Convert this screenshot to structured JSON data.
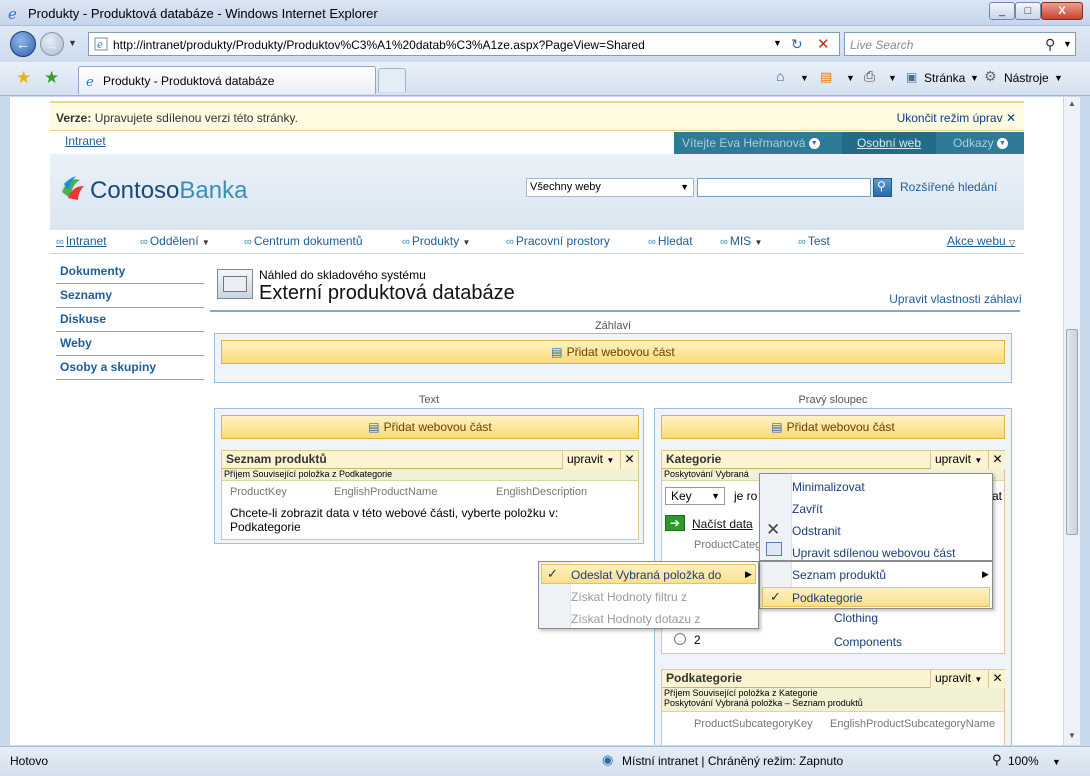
{
  "window": {
    "title": "Produkty - Produktová databáze - Windows Internet Explorer",
    "buttons": [
      "_",
      "□",
      "X"
    ]
  },
  "address": {
    "url": "http://intranet/produkty/Produkty/Produktov%C3%A1%20datab%C3%A1ze.aspx?PageView=Shared",
    "search_placeholder": "Live Search"
  },
  "tab": {
    "label": "Produkty - Produktová databáze"
  },
  "commandbar": {
    "page": "Stránka",
    "tools": "Nástroje"
  },
  "editmode": {
    "label": "Verze:",
    "text": "Upravujete sdílenou verzi této stránky.",
    "exit": "Ukončit režim úprav"
  },
  "topnav": {
    "site": "Intranet",
    "welcome": "Vítejte Eva Heřmanová",
    "mysite": "Osobní web",
    "links": "Odkazy"
  },
  "banner": {
    "logo_part1": "Contoso",
    "logo_part2": "Banka",
    "scope": "Všechny weby",
    "advanced": "Rozšířené hledání"
  },
  "globalnav": {
    "items": [
      "Intranet",
      "Oddělení",
      "Centrum dokumentů",
      "Produkty",
      "Pracovní prostory",
      "Hledat",
      "MIS",
      "Test"
    ],
    "site_actions": "Akce webu"
  },
  "quicklaunch": [
    "Dokumenty",
    "Seznamy",
    "Diskuse",
    "Weby",
    "Osoby a skupiny"
  ],
  "page": {
    "subtitle": "Náhled do skladového systému",
    "title": "Externí produktová databáze",
    "edit_title": "Upravit vlastnosti záhlaví"
  },
  "zones": {
    "header": "Záhlaví",
    "left": "Text",
    "right": "Pravý sloupec",
    "add_webpart": "Přidat webovou část"
  },
  "webparts": {
    "products": {
      "title": "Seznam produktů",
      "menu": "upravit",
      "conn": "Příjem Související položka z Podkategorie",
      "cols": [
        "ProductKey",
        "EnglishProductName",
        "EnglishDescription"
      ],
      "msg": "Chcete-li zobrazit data v této webové části, vyberte položku v: Podkategorie"
    },
    "categories": {
      "title": "Kategorie",
      "menu": "upravit",
      "conn": "Poskytování Vybraná",
      "filter_field": "Key",
      "filter_op": "je ro",
      "filter_end": "at",
      "load": "Načíst data",
      "col": "ProductCateg",
      "rows": [
        {
          "key": "",
          "name": "Clothing"
        },
        {
          "key": "2",
          "name": "Components"
        }
      ]
    },
    "subcategories": {
      "title": "Podkategorie",
      "menu": "upravit",
      "conn1": "Příjem Související položka z Kategorie",
      "conn2": "Poskytování Vybraná položka – Seznam produktů",
      "cols": [
        "ProductSubcategoryKey",
        "EnglishProductSubcategoryName"
      ]
    }
  },
  "menus": {
    "webpart": [
      "Minimalizovat",
      "Zavřít",
      "Odstranit",
      "Upravit sdílenou webovou část"
    ],
    "connections": [
      "Odeslat Vybraná položka do",
      "Získat Hodnoty filtru z",
      "Získat Hodnoty dotazu z"
    ],
    "targets": [
      "Seznam produktů",
      "Podkategorie"
    ]
  },
  "statusbar": {
    "left": "Hotovo",
    "zone": "Místní intranet | Chráněný režim: Zapnuto",
    "zoom": "100%"
  },
  "colors": {
    "accent": "#1e5d98",
    "banner": "#2f7a96",
    "highlight": "#fbe08a"
  }
}
